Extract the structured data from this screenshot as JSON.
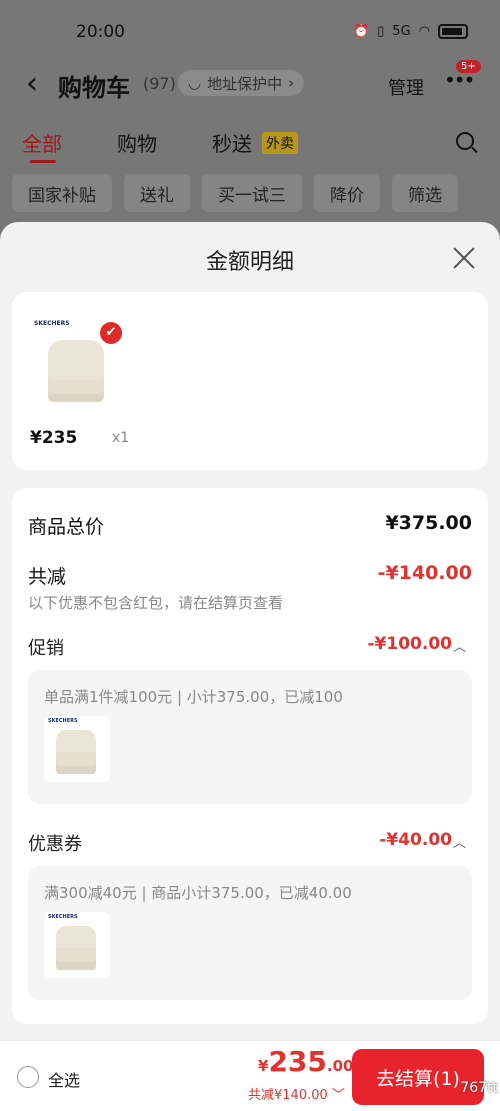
{
  "status": {
    "time": "20:00",
    "network": "5G"
  },
  "nav": {
    "back": "‹",
    "title": "购物车",
    "count": "(97)",
    "address_protect": "地址保护中",
    "manage": "管理",
    "more": "•••",
    "badge": "5+"
  },
  "tabs": [
    {
      "label": "全部",
      "active": true
    },
    {
      "label": "购物"
    },
    {
      "label": "秒送"
    }
  ],
  "tab_tag": "外卖",
  "filters": [
    "国家补贴",
    "送礼",
    "买一试三",
    "降价",
    "筛选"
  ],
  "sheet": {
    "title": "金额明细",
    "product": {
      "brand": "SKECHERS",
      "price": "¥235",
      "qty": "x1"
    },
    "total_label": "商品总价",
    "total_value": "¥375.00",
    "reduce_label": "共减",
    "reduce_value": "-¥140.00",
    "reduce_note": "以下优惠不包含红包，请在结算页查看",
    "promo_label": "促销",
    "promo_value": "-¥100.00",
    "promo_desc": "单品满1件减100元 | 小计375.00，已减100",
    "coupon_label": "优惠券",
    "coupon_value": "-¥40.00",
    "coupon_desc": "满300减40元 | 商品小计375.00，已减40.00"
  },
  "bottom": {
    "select_all": "全选",
    "yen": "¥",
    "amount_int": "235",
    "amount_dec": ".00",
    "discount": "共减¥140.00",
    "checkout": "去结算(1)",
    "watermark": "767tt"
  }
}
